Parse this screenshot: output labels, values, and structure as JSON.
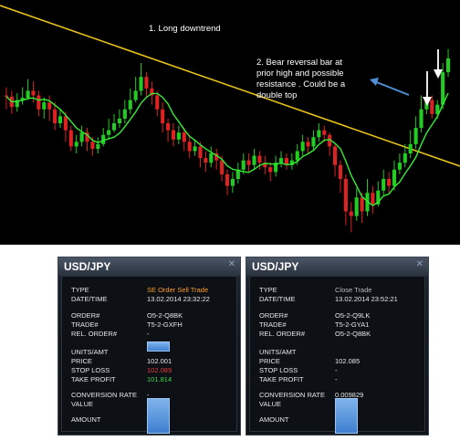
{
  "chart": {
    "annotations": {
      "a1": "1. Long downtrend",
      "a2_lines": [
        "2. Bear reversal bar at",
        "prior high and possible",
        "resistance .  Could be a",
        "double top"
      ]
    },
    "colors": {
      "background": "#000000",
      "up": "#22cc22",
      "down": "#dd2222",
      "ma": "#33ee33",
      "trendline": "#e8c21a",
      "arrow_blue": "#4f8fd8",
      "arrow_white": "#ffffff"
    },
    "candles": [
      [
        0.62,
        0.615,
        0.655,
        0.56
      ],
      [
        0.615,
        0.57,
        0.64,
        0.54
      ],
      [
        0.57,
        0.6,
        0.63,
        0.55
      ],
      [
        0.6,
        0.61,
        0.655,
        0.58
      ],
      [
        0.61,
        0.64,
        0.69,
        0.6
      ],
      [
        0.64,
        0.62,
        0.68,
        0.59
      ],
      [
        0.62,
        0.56,
        0.64,
        0.53
      ],
      [
        0.56,
        0.59,
        0.61,
        0.52
      ],
      [
        0.59,
        0.56,
        0.62,
        0.51
      ],
      [
        0.56,
        0.5,
        0.59,
        0.47
      ],
      [
        0.5,
        0.53,
        0.56,
        0.48
      ],
      [
        0.53,
        0.47,
        0.55,
        0.42
      ],
      [
        0.47,
        0.4,
        0.49,
        0.38
      ],
      [
        0.4,
        0.42,
        0.45,
        0.37
      ],
      [
        0.42,
        0.46,
        0.49,
        0.4
      ],
      [
        0.46,
        0.42,
        0.48,
        0.38
      ],
      [
        0.42,
        0.39,
        0.44,
        0.36
      ],
      [
        0.39,
        0.41,
        0.44,
        0.37
      ],
      [
        0.41,
        0.45,
        0.48,
        0.4
      ],
      [
        0.45,
        0.47,
        0.52,
        0.43
      ],
      [
        0.47,
        0.5,
        0.54,
        0.46
      ],
      [
        0.5,
        0.52,
        0.56,
        0.48
      ],
      [
        0.52,
        0.56,
        0.6,
        0.5
      ],
      [
        0.56,
        0.6,
        0.65,
        0.54
      ],
      [
        0.6,
        0.64,
        0.7,
        0.59
      ],
      [
        0.64,
        0.7,
        0.76,
        0.62
      ],
      [
        0.7,
        0.65,
        0.72,
        0.61
      ],
      [
        0.65,
        0.62,
        0.68,
        0.58
      ],
      [
        0.62,
        0.56,
        0.64,
        0.53
      ],
      [
        0.56,
        0.5,
        0.59,
        0.46
      ],
      [
        0.5,
        0.47,
        0.52,
        0.42
      ],
      [
        0.47,
        0.43,
        0.5,
        0.4
      ],
      [
        0.43,
        0.46,
        0.49,
        0.41
      ],
      [
        0.46,
        0.42,
        0.48,
        0.38
      ],
      [
        0.42,
        0.38,
        0.45,
        0.35
      ],
      [
        0.38,
        0.4,
        0.43,
        0.36
      ],
      [
        0.4,
        0.35,
        0.42,
        0.31
      ],
      [
        0.35,
        0.33,
        0.38,
        0.29
      ],
      [
        0.33,
        0.37,
        0.4,
        0.31
      ],
      [
        0.37,
        0.34,
        0.39,
        0.3
      ],
      [
        0.34,
        0.28,
        0.36,
        0.25
      ],
      [
        0.28,
        0.23,
        0.3,
        0.19
      ],
      [
        0.23,
        0.26,
        0.29,
        0.2
      ],
      [
        0.26,
        0.3,
        0.33,
        0.24
      ],
      [
        0.3,
        0.34,
        0.37,
        0.28
      ],
      [
        0.34,
        0.32,
        0.37,
        0.29
      ],
      [
        0.32,
        0.36,
        0.39,
        0.3
      ],
      [
        0.36,
        0.33,
        0.38,
        0.3
      ],
      [
        0.33,
        0.31,
        0.36,
        0.28
      ],
      [
        0.31,
        0.29,
        0.33,
        0.25
      ],
      [
        0.29,
        0.33,
        0.36,
        0.27
      ],
      [
        0.33,
        0.35,
        0.38,
        0.31
      ],
      [
        0.35,
        0.32,
        0.37,
        0.3
      ],
      [
        0.32,
        0.34,
        0.37,
        0.3
      ],
      [
        0.34,
        0.38,
        0.41,
        0.32
      ],
      [
        0.38,
        0.42,
        0.45,
        0.36
      ],
      [
        0.42,
        0.4,
        0.44,
        0.37
      ],
      [
        0.4,
        0.44,
        0.47,
        0.38
      ],
      [
        0.44,
        0.47,
        0.5,
        0.42
      ],
      [
        0.47,
        0.45,
        0.49,
        0.42
      ],
      [
        0.45,
        0.4,
        0.46,
        0.36
      ],
      [
        0.4,
        0.32,
        0.41,
        0.27
      ],
      [
        0.32,
        0.26,
        0.34,
        0.2
      ],
      [
        0.26,
        0.12,
        0.28,
        0.06
      ],
      [
        0.12,
        0.1,
        0.16,
        0.03
      ],
      [
        0.1,
        0.18,
        0.22,
        0.08
      ],
      [
        0.18,
        0.12,
        0.2,
        0.07
      ],
      [
        0.12,
        0.2,
        0.26,
        0.1
      ],
      [
        0.2,
        0.15,
        0.23,
        0.11
      ],
      [
        0.15,
        0.21,
        0.25,
        0.14
      ],
      [
        0.21,
        0.26,
        0.3,
        0.19
      ],
      [
        0.26,
        0.23,
        0.29,
        0.2
      ],
      [
        0.23,
        0.3,
        0.34,
        0.21
      ],
      [
        0.3,
        0.33,
        0.37,
        0.28
      ],
      [
        0.33,
        0.37,
        0.41,
        0.31
      ],
      [
        0.37,
        0.41,
        0.47,
        0.35
      ],
      [
        0.41,
        0.48,
        0.53,
        0.39
      ],
      [
        0.48,
        0.56,
        0.62,
        0.46
      ],
      [
        0.56,
        0.6,
        0.64,
        0.54
      ],
      [
        0.6,
        0.54,
        0.62,
        0.52
      ],
      [
        0.54,
        0.58,
        0.6,
        0.52
      ],
      [
        0.58,
        0.72,
        0.76,
        0.56
      ],
      [
        0.72,
        0.78,
        0.82,
        0.7
      ]
    ]
  },
  "panels": [
    {
      "title": "USD/JPY",
      "close": "✕",
      "rows": {
        "type": {
          "label": "TYPE",
          "value": "SE Order Sell Trade",
          "color": "#ff9a2a"
        },
        "datetime": {
          "label": "DATE/TIME",
          "value": "13.02.2014 23:32:22",
          "color": "#e6e6e6"
        },
        "order": {
          "label": "ORDER#",
          "value": "O5-2-Q8BK",
          "color": "#e6e6e6"
        },
        "trade": {
          "label": "TRADE#",
          "value": "T5-2-GXFH",
          "color": "#e6e6e6"
        },
        "rel_order": {
          "label": "REL. ORDER#",
          "value": "-",
          "color": "#e6e6e6"
        },
        "units": {
          "label": "UNITS/AMT",
          "value": "",
          "color": "#e6e6e6"
        },
        "price": {
          "label": "PRICE",
          "value": "102.001",
          "color": "#e6e6e6"
        },
        "stop_loss": {
          "label": "STOP LOSS",
          "value": "102.089",
          "color": "#e23a3a"
        },
        "take_profit": {
          "label": "TAKE PROFIT",
          "value": "101.814",
          "color": "#3dd64a"
        },
        "conversion": {
          "label": "CONVERSION RATE",
          "value": "-",
          "color": "#e6e6e6"
        },
        "value": {
          "label": "VALUE",
          "value": "",
          "color": "#e6e6e6"
        },
        "amount": {
          "label": "AMOUNT",
          "value": "",
          "color": "#e6e6e6"
        }
      }
    },
    {
      "title": "USD/JPY",
      "close": "✕",
      "rows": {
        "type": {
          "label": "TYPE",
          "value": "Close Trade",
          "color": "#b8b8b8"
        },
        "datetime": {
          "label": "DATE/TIME",
          "value": "13.02.2014 23:52:21",
          "color": "#e6e6e6"
        },
        "order": {
          "label": "ORDER#",
          "value": "O5-2-Q9LK",
          "color": "#e6e6e6"
        },
        "trade": {
          "label": "TRADE#",
          "value": "T5-2-GYA1",
          "color": "#e6e6e6"
        },
        "rel_order": {
          "label": "REL. ORDER#",
          "value": "O5-2-Q8BK",
          "color": "#e6e6e6"
        },
        "units": {
          "label": "UNITS/AMT",
          "value": "",
          "color": "#e6e6e6"
        },
        "price": {
          "label": "PRICE",
          "value": "102.085",
          "color": "#e6e6e6"
        },
        "stop_loss": {
          "label": "STOP LOSS",
          "value": "-",
          "color": "#e6e6e6"
        },
        "take_profit": {
          "label": "TAKE PROFIT",
          "value": "-",
          "color": "#e6e6e6"
        },
        "conversion": {
          "label": "CONVERSION RATE",
          "value": "0.009829",
          "color": "#e6e6e6"
        },
        "value": {
          "label": "VALUE",
          "value": "",
          "color": "#e6e6e6"
        },
        "amount": {
          "label": "AMOUNT",
          "value": "",
          "color": "#e6e6e6"
        }
      }
    }
  ]
}
